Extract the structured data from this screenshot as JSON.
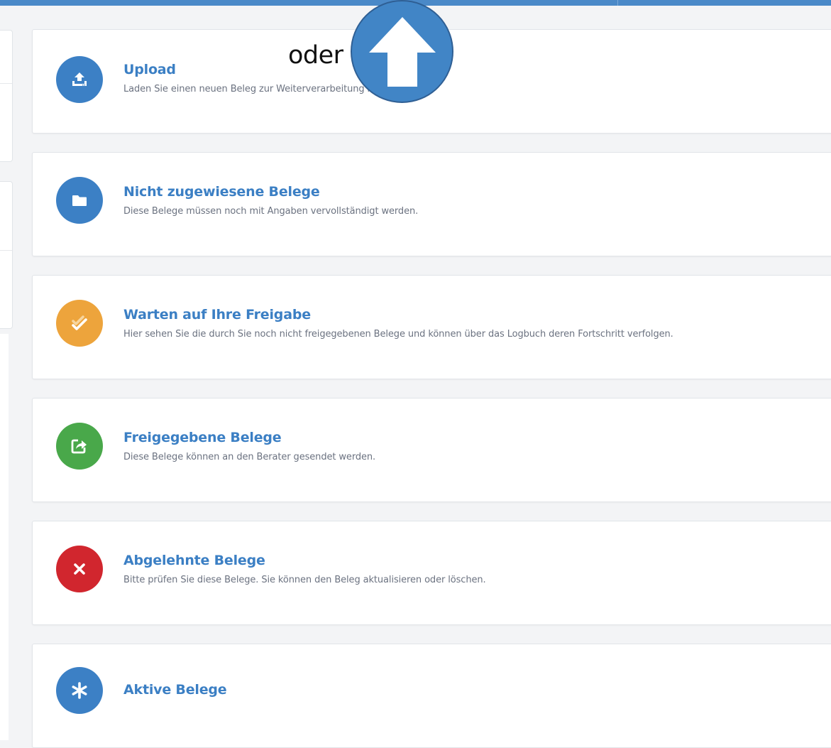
{
  "colors": {
    "accent": "#3b7fc4",
    "blue": "#3c80c5",
    "orange": "#eda43c",
    "green": "#49a84a",
    "red": "#d1262e"
  },
  "annotation": {
    "label": "oder",
    "icon": "up-arrow-icon"
  },
  "cards": [
    {
      "title": "Upload",
      "description": "Laden Sie einen neuen Beleg zur Weiterverarbeitung hoch.",
      "icon": "upload-icon",
      "color": "#3c80c5"
    },
    {
      "title": "Nicht zugewiesene Belege",
      "description": "Diese Belege müssen noch mit Angaben vervollständigt werden.",
      "icon": "folder-icon",
      "color": "#3c80c5"
    },
    {
      "title": "Warten auf Ihre Freigabe",
      "description": "Hier sehen Sie die durch Sie noch nicht freigegebenen Belege und können über das Logbuch deren Fortschritt verfolgen.",
      "icon": "double-check-icon",
      "color": "#eda43c"
    },
    {
      "title": "Freigegebene Belege",
      "description": "Diese Belege können an den Berater gesendet werden.",
      "icon": "share-icon",
      "color": "#49a84a"
    },
    {
      "title": "Abgelehnte Belege",
      "description": "Bitte prüfen Sie diese Belege. Sie können den Beleg aktualisieren oder löschen.",
      "icon": "close-icon",
      "color": "#d1262e"
    },
    {
      "title": "Aktive Belege",
      "description": "",
      "icon": "asterisk-icon",
      "color": "#3c80c5"
    }
  ]
}
